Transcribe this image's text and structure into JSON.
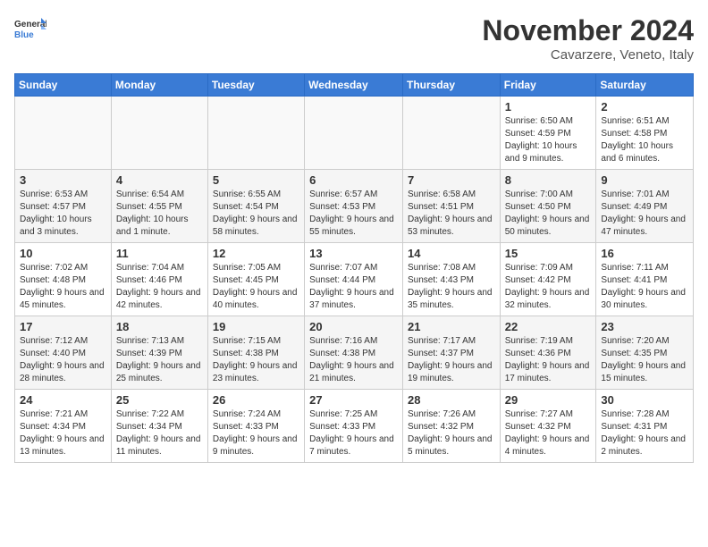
{
  "logo": {
    "line1": "General",
    "line2": "Blue"
  },
  "title": "November 2024",
  "subtitle": "Cavarzere, Veneto, Italy",
  "weekdays": [
    "Sunday",
    "Monday",
    "Tuesday",
    "Wednesday",
    "Thursday",
    "Friday",
    "Saturday"
  ],
  "weeks": [
    [
      {
        "day": "",
        "info": ""
      },
      {
        "day": "",
        "info": ""
      },
      {
        "day": "",
        "info": ""
      },
      {
        "day": "",
        "info": ""
      },
      {
        "day": "",
        "info": ""
      },
      {
        "day": "1",
        "info": "Sunrise: 6:50 AM\nSunset: 4:59 PM\nDaylight: 10 hours and 9 minutes."
      },
      {
        "day": "2",
        "info": "Sunrise: 6:51 AM\nSunset: 4:58 PM\nDaylight: 10 hours and 6 minutes."
      }
    ],
    [
      {
        "day": "3",
        "info": "Sunrise: 6:53 AM\nSunset: 4:57 PM\nDaylight: 10 hours and 3 minutes."
      },
      {
        "day": "4",
        "info": "Sunrise: 6:54 AM\nSunset: 4:55 PM\nDaylight: 10 hours and 1 minute."
      },
      {
        "day": "5",
        "info": "Sunrise: 6:55 AM\nSunset: 4:54 PM\nDaylight: 9 hours and 58 minutes."
      },
      {
        "day": "6",
        "info": "Sunrise: 6:57 AM\nSunset: 4:53 PM\nDaylight: 9 hours and 55 minutes."
      },
      {
        "day": "7",
        "info": "Sunrise: 6:58 AM\nSunset: 4:51 PM\nDaylight: 9 hours and 53 minutes."
      },
      {
        "day": "8",
        "info": "Sunrise: 7:00 AM\nSunset: 4:50 PM\nDaylight: 9 hours and 50 minutes."
      },
      {
        "day": "9",
        "info": "Sunrise: 7:01 AM\nSunset: 4:49 PM\nDaylight: 9 hours and 47 minutes."
      }
    ],
    [
      {
        "day": "10",
        "info": "Sunrise: 7:02 AM\nSunset: 4:48 PM\nDaylight: 9 hours and 45 minutes."
      },
      {
        "day": "11",
        "info": "Sunrise: 7:04 AM\nSunset: 4:46 PM\nDaylight: 9 hours and 42 minutes."
      },
      {
        "day": "12",
        "info": "Sunrise: 7:05 AM\nSunset: 4:45 PM\nDaylight: 9 hours and 40 minutes."
      },
      {
        "day": "13",
        "info": "Sunrise: 7:07 AM\nSunset: 4:44 PM\nDaylight: 9 hours and 37 minutes."
      },
      {
        "day": "14",
        "info": "Sunrise: 7:08 AM\nSunset: 4:43 PM\nDaylight: 9 hours and 35 minutes."
      },
      {
        "day": "15",
        "info": "Sunrise: 7:09 AM\nSunset: 4:42 PM\nDaylight: 9 hours and 32 minutes."
      },
      {
        "day": "16",
        "info": "Sunrise: 7:11 AM\nSunset: 4:41 PM\nDaylight: 9 hours and 30 minutes."
      }
    ],
    [
      {
        "day": "17",
        "info": "Sunrise: 7:12 AM\nSunset: 4:40 PM\nDaylight: 9 hours and 28 minutes."
      },
      {
        "day": "18",
        "info": "Sunrise: 7:13 AM\nSunset: 4:39 PM\nDaylight: 9 hours and 25 minutes."
      },
      {
        "day": "19",
        "info": "Sunrise: 7:15 AM\nSunset: 4:38 PM\nDaylight: 9 hours and 23 minutes."
      },
      {
        "day": "20",
        "info": "Sunrise: 7:16 AM\nSunset: 4:38 PM\nDaylight: 9 hours and 21 minutes."
      },
      {
        "day": "21",
        "info": "Sunrise: 7:17 AM\nSunset: 4:37 PM\nDaylight: 9 hours and 19 minutes."
      },
      {
        "day": "22",
        "info": "Sunrise: 7:19 AM\nSunset: 4:36 PM\nDaylight: 9 hours and 17 minutes."
      },
      {
        "day": "23",
        "info": "Sunrise: 7:20 AM\nSunset: 4:35 PM\nDaylight: 9 hours and 15 minutes."
      }
    ],
    [
      {
        "day": "24",
        "info": "Sunrise: 7:21 AM\nSunset: 4:34 PM\nDaylight: 9 hours and 13 minutes."
      },
      {
        "day": "25",
        "info": "Sunrise: 7:22 AM\nSunset: 4:34 PM\nDaylight: 9 hours and 11 minutes."
      },
      {
        "day": "26",
        "info": "Sunrise: 7:24 AM\nSunset: 4:33 PM\nDaylight: 9 hours and 9 minutes."
      },
      {
        "day": "27",
        "info": "Sunrise: 7:25 AM\nSunset: 4:33 PM\nDaylight: 9 hours and 7 minutes."
      },
      {
        "day": "28",
        "info": "Sunrise: 7:26 AM\nSunset: 4:32 PM\nDaylight: 9 hours and 5 minutes."
      },
      {
        "day": "29",
        "info": "Sunrise: 7:27 AM\nSunset: 4:32 PM\nDaylight: 9 hours and 4 minutes."
      },
      {
        "day": "30",
        "info": "Sunrise: 7:28 AM\nSunset: 4:31 PM\nDaylight: 9 hours and 2 minutes."
      }
    ]
  ]
}
